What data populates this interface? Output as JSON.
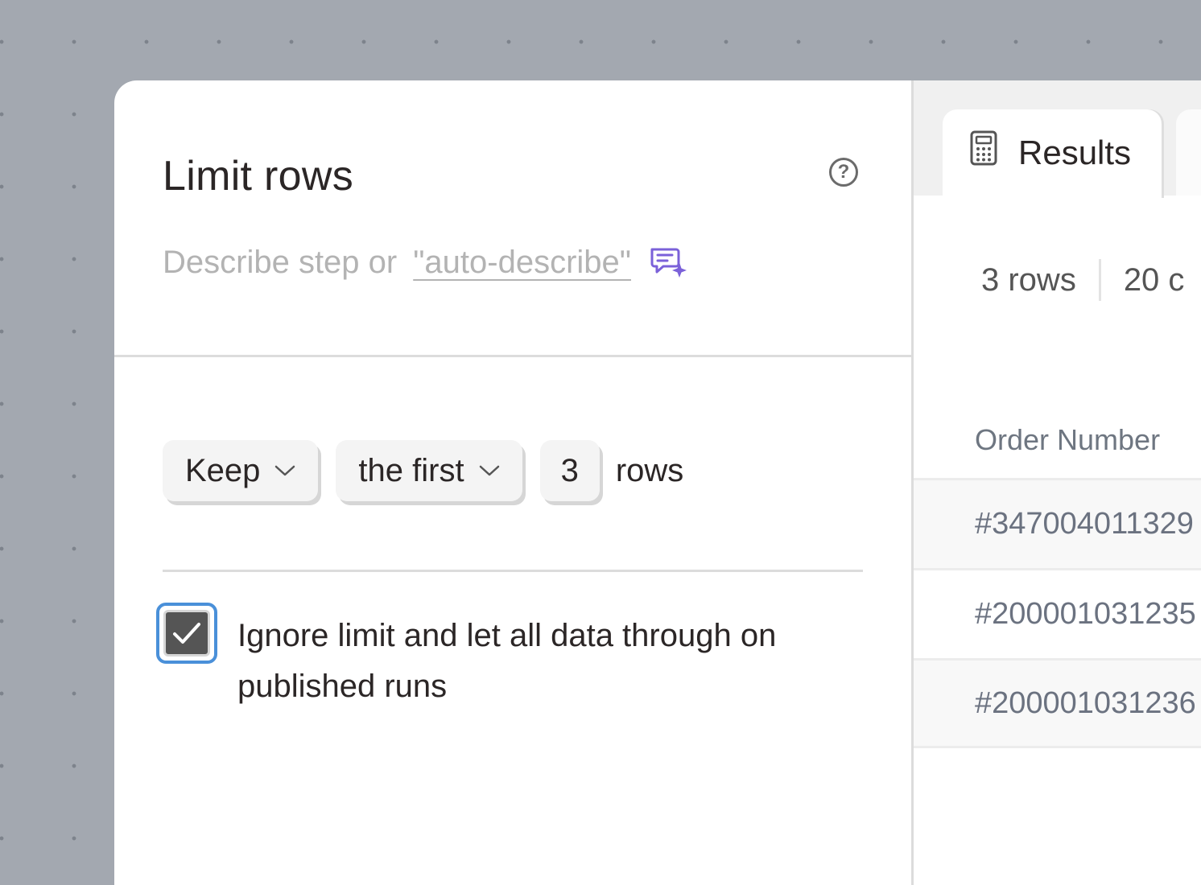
{
  "step": {
    "title": "Limit rows",
    "describe_prefix": "Describe step or",
    "describe_link": "\"auto-describe\"",
    "mode_label": "Keep",
    "position_label": "the first",
    "count_value": "3",
    "unit_label": "rows",
    "ignore_limit_label": "Ignore limit and let all data through on published runs",
    "ignore_limit_checked": true
  },
  "results": {
    "tab_label": "Results",
    "row_count": "3 rows",
    "col_count": "20 c",
    "column_header": "Order Number",
    "rows": [
      "#347004011329",
      "#200001031235",
      "#200001031236"
    ]
  },
  "colors": {
    "accent": "#4a90d9",
    "ai_purple": "#7b61d9"
  }
}
